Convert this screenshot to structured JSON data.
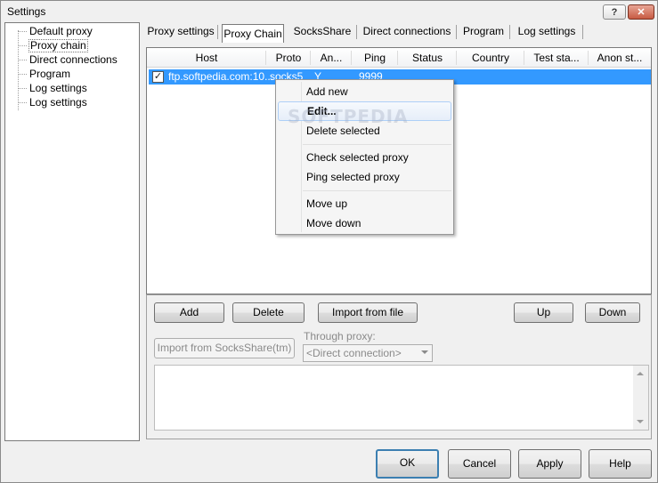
{
  "window": {
    "title": "Settings",
    "help_glyph": "?",
    "close_glyph": "✕"
  },
  "tree": {
    "items": [
      "Default proxy",
      "Proxy chain",
      "Direct connections",
      "Program",
      "Log settings",
      "Log settings"
    ],
    "selected_index": 1
  },
  "tabs": [
    "Proxy settings",
    "Proxy Chain",
    "SocksShare",
    "Direct connections",
    "Program",
    "Log settings"
  ],
  "active_tab_index": 1,
  "grid": {
    "columns": [
      "Host",
      "Proto",
      "An...",
      "Ping",
      "Status",
      "Country",
      "Test sta...",
      "Anon st..."
    ],
    "rows": [
      {
        "checked": true,
        "check_glyph": "✓",
        "host": "ftp.softpedia.com:10...",
        "proto": "socks5",
        "anon": "Y",
        "ping": "9999",
        "selected": true
      }
    ]
  },
  "context_menu": {
    "items": [
      "Add new",
      "Edit...",
      "Delete selected",
      "Check selected proxy",
      "Ping selected proxy",
      "Move up",
      "Move down"
    ],
    "highlighted_index": 1
  },
  "watermark": "SOFTPEDIA",
  "chain_buttons": {
    "add": "Add",
    "delete": "Delete",
    "import_file": "Import from file",
    "up": "Up",
    "down": "Down",
    "import_socksshare": "Import from SocksShare(tm)"
  },
  "through_proxy": {
    "label": "Through proxy:",
    "value": "<Direct connection>"
  },
  "footer": {
    "ok": "OK",
    "cancel": "Cancel",
    "apply": "Apply",
    "help": "Help"
  }
}
